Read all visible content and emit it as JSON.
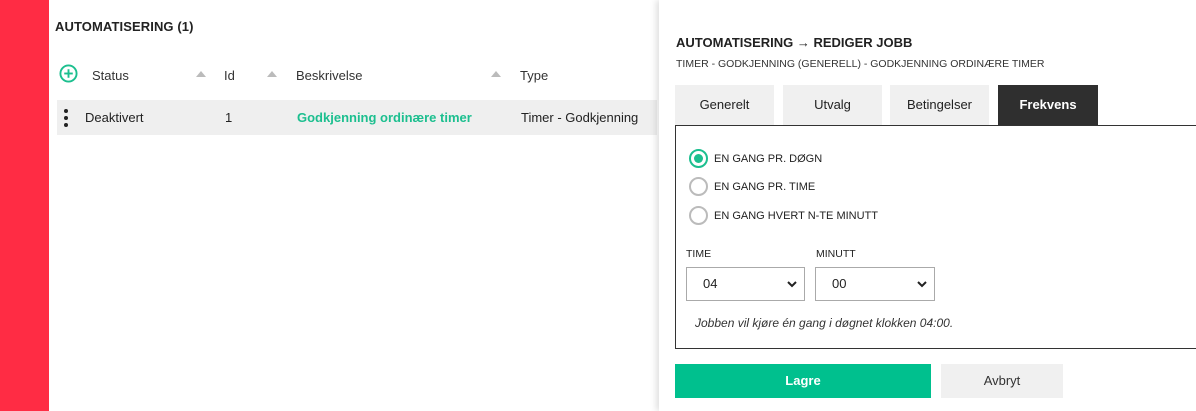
{
  "colors": {
    "brand_red": "#ff2c44",
    "accent_green": "#00c08e",
    "active_tab": "#2f2f2f"
  },
  "list": {
    "title": "AUTOMATISERING (1)",
    "add_icon": "plus-circle-icon",
    "columns": [
      "Status",
      "Id",
      "Beskrivelse",
      "Type"
    ],
    "rows": [
      {
        "status": "Deaktivert",
        "id": "1",
        "description": "Godkjenning ordinære timer",
        "type": "Timer - Godkjenning"
      }
    ]
  },
  "panel": {
    "title": "AUTOMATISERING → REDIGER JOBB",
    "subtitle": "TIMER - GODKJENNING (GENERELL) - GODKJENNING ORDINÆRE TIMER",
    "tabs": [
      {
        "label": "Generelt",
        "active": false
      },
      {
        "label": "Utvalg",
        "active": false
      },
      {
        "label": "Betingelser",
        "active": false
      },
      {
        "label": "Frekvens",
        "active": true
      }
    ],
    "frequency": {
      "options": [
        {
          "label": "EN GANG PR. DØGN",
          "checked": true
        },
        {
          "label": "EN GANG PR. TIME",
          "checked": false
        },
        {
          "label": "EN GANG HVERT N-TE MINUTT",
          "checked": false
        }
      ],
      "hour_label": "TIME",
      "hour_value": "04",
      "minute_label": "MINUTT",
      "minute_value": "00",
      "hint": "Jobben vil kjøre én gang i døgnet klokken 04:00."
    },
    "save_label": "Lagre",
    "cancel_label": "Avbryt"
  }
}
